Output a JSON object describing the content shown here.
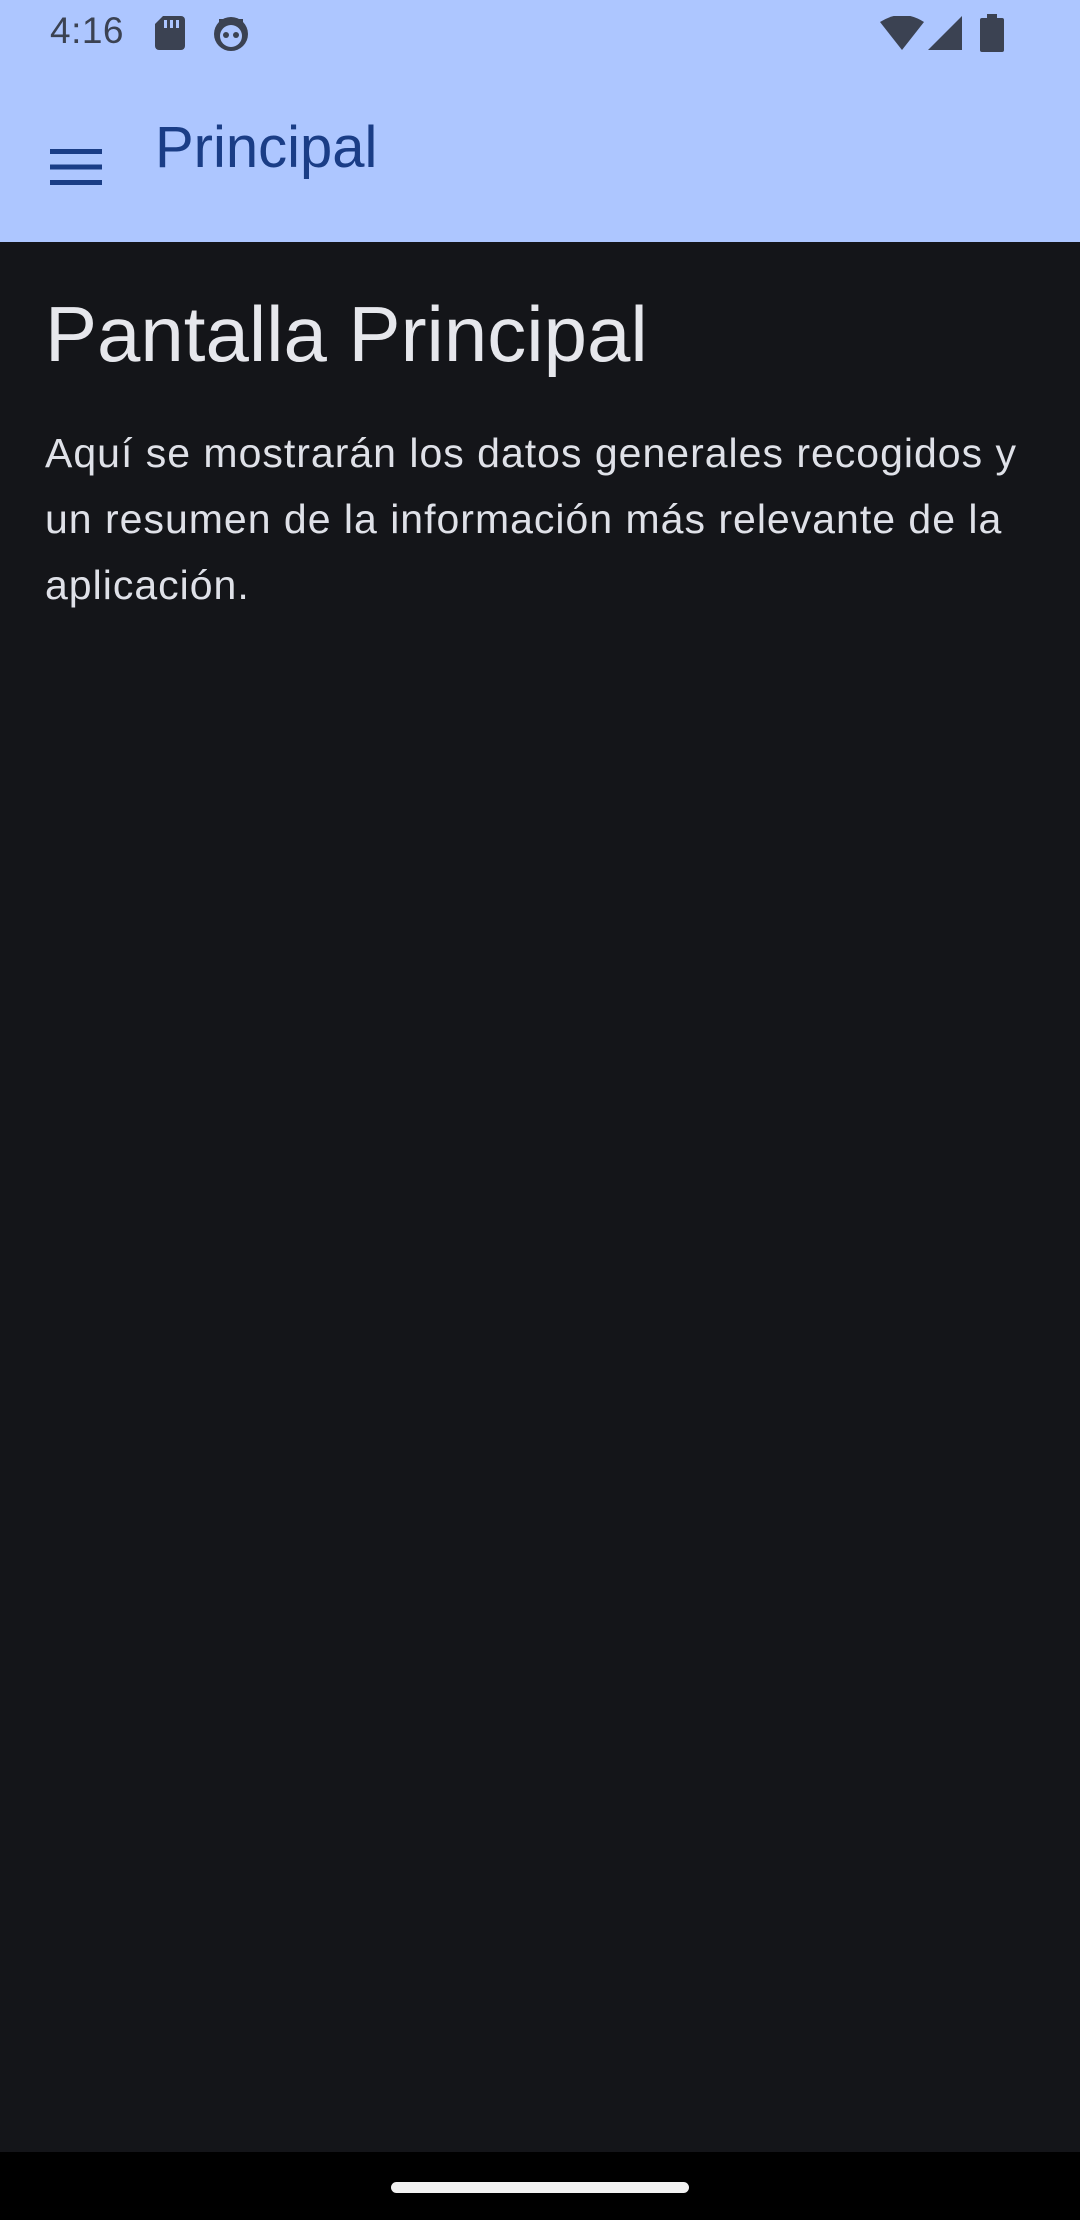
{
  "status_bar": {
    "time": "4:16",
    "left_icons": [
      "sd-card-icon",
      "robot-face-icon"
    ],
    "right_icons": [
      "wifi-icon",
      "cellular-signal-icon",
      "battery-icon"
    ]
  },
  "app_bar": {
    "menu_icon": "hamburger-menu-icon",
    "title": "Principal"
  },
  "main": {
    "heading": "Pantalla Principal",
    "body": "Aquí se mostrarán los datos generales recogidos y un resumen de la información más relevante de la aplicación."
  },
  "colors": {
    "app_bar_background": "#adc6ff",
    "title_color": "#1a3d86",
    "screen_background": "#141519",
    "text_color": "#e6e7ec",
    "nav_bar_background": "#000000"
  }
}
